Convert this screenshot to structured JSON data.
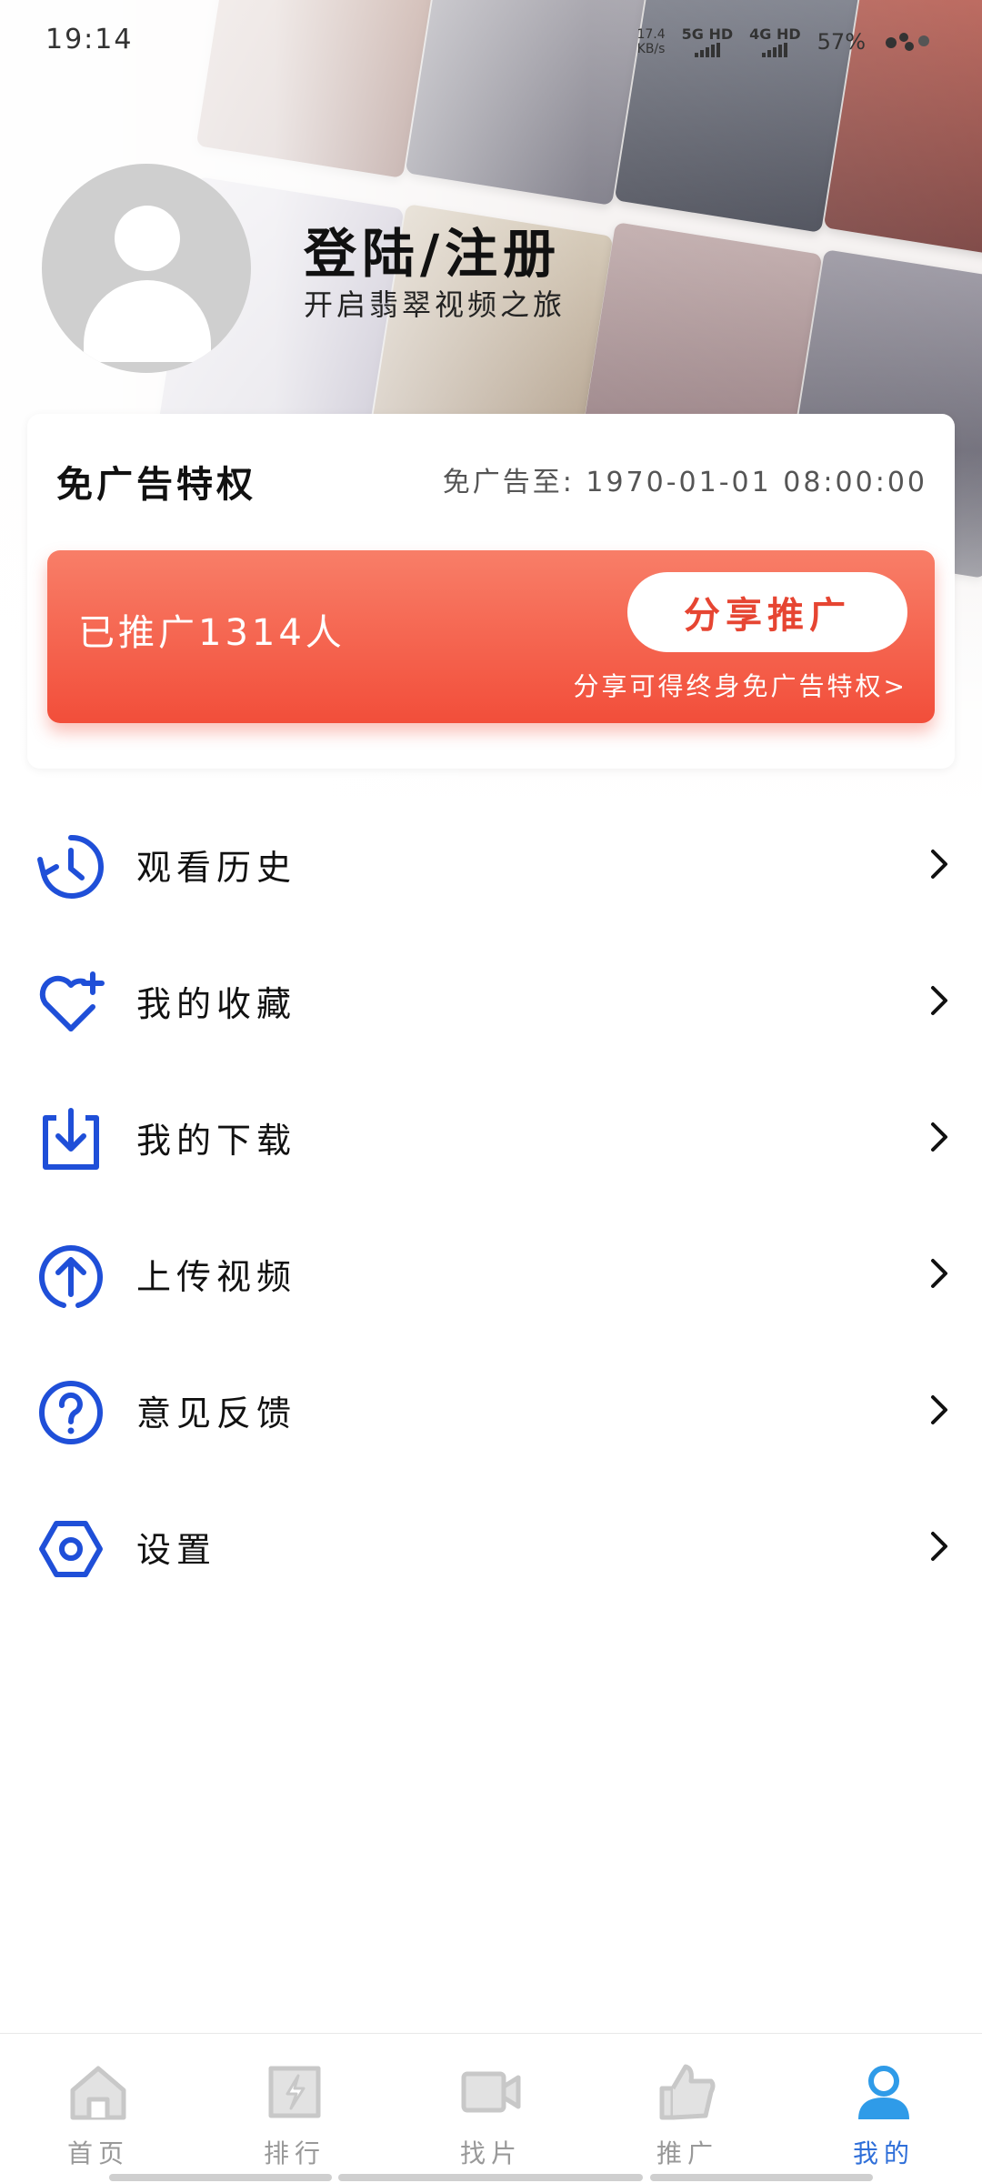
{
  "status_bar": {
    "time": "19:14",
    "net_speed_value": "17.4",
    "net_speed_unit": "KB/s",
    "signal_1": "5G HD",
    "signal_2": "4G HD",
    "battery": "57%"
  },
  "profile": {
    "title": "登陆/注册",
    "subtitle": "开启翡翠视频之旅"
  },
  "ad_free": {
    "title": "免广告特权",
    "expire_text": "免广告至: 1970-01-01 08:00:00",
    "promoted_text": "已推广1314人",
    "share_button": "分享推广",
    "share_hint": "分享可得终身免广告特权>"
  },
  "menu": {
    "items": [
      {
        "label": "观看历史",
        "icon": "history-icon"
      },
      {
        "label": "我的收藏",
        "icon": "favorite-icon"
      },
      {
        "label": "我的下载",
        "icon": "download-icon"
      },
      {
        "label": "上传视频",
        "icon": "upload-icon"
      },
      {
        "label": "意见反馈",
        "icon": "feedback-icon"
      },
      {
        "label": "设置",
        "icon": "settings-icon"
      }
    ]
  },
  "bottom_nav": {
    "items": [
      {
        "label": "首页",
        "icon": "home-icon"
      },
      {
        "label": "排行",
        "icon": "ranking-icon"
      },
      {
        "label": "找片",
        "icon": "video-camera-icon"
      },
      {
        "label": "推广",
        "icon": "thumbs-up-icon"
      },
      {
        "label": "我的",
        "icon": "user-icon",
        "active": true
      }
    ]
  },
  "colors": {
    "accent_blue": "#1f4fd8",
    "promo_red": "#f24e3a",
    "nav_active": "#2f6fd9",
    "nav_inactive": "#c8c8c8"
  }
}
